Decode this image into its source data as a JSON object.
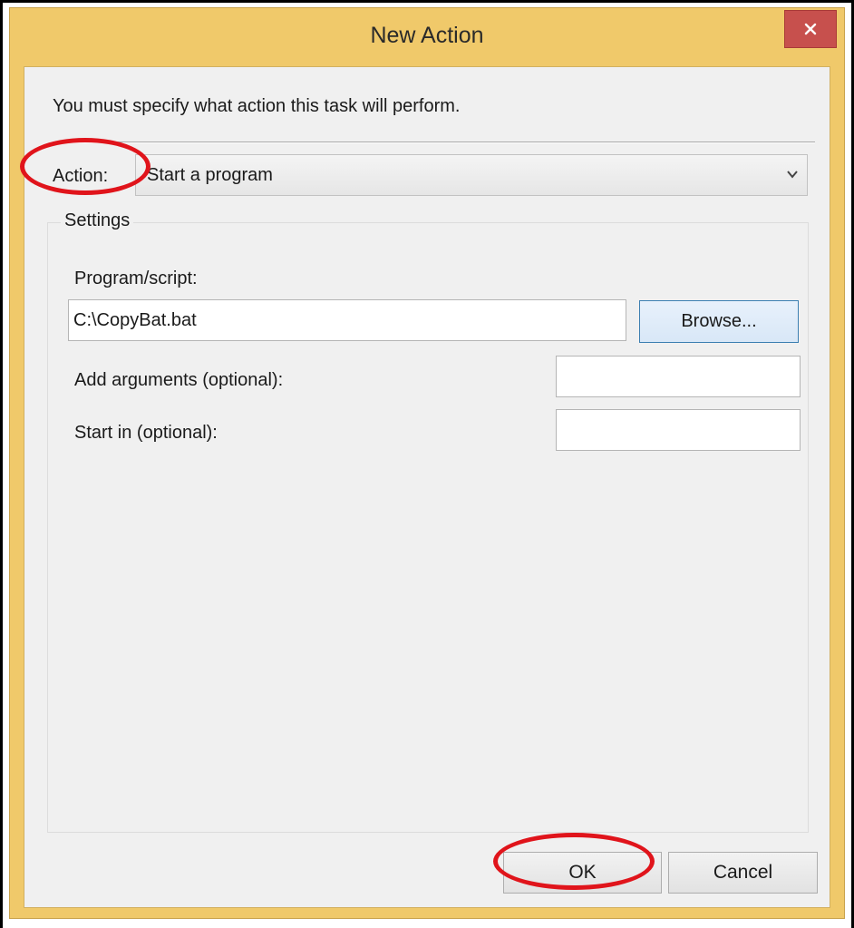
{
  "window": {
    "title": "New Action",
    "close_glyph": "×"
  },
  "dialog": {
    "instruction": "You must specify what action this task will perform.",
    "action_label": "Action:",
    "action_value": "Start a program"
  },
  "settings": {
    "legend": "Settings",
    "program_label": "Program/script:",
    "program_value": "C:\\CopyBat.bat",
    "browse_label": "Browse...",
    "arguments_label": "Add arguments (optional):",
    "arguments_value": "",
    "start_in_label": "Start in (optional):",
    "start_in_value": ""
  },
  "buttons": {
    "ok_label": "OK",
    "cancel_label": "Cancel"
  },
  "annotations": {
    "color": "#e0141b"
  },
  "icons": {
    "close": "close-icon",
    "dropdown": "chevron-down-icon"
  }
}
